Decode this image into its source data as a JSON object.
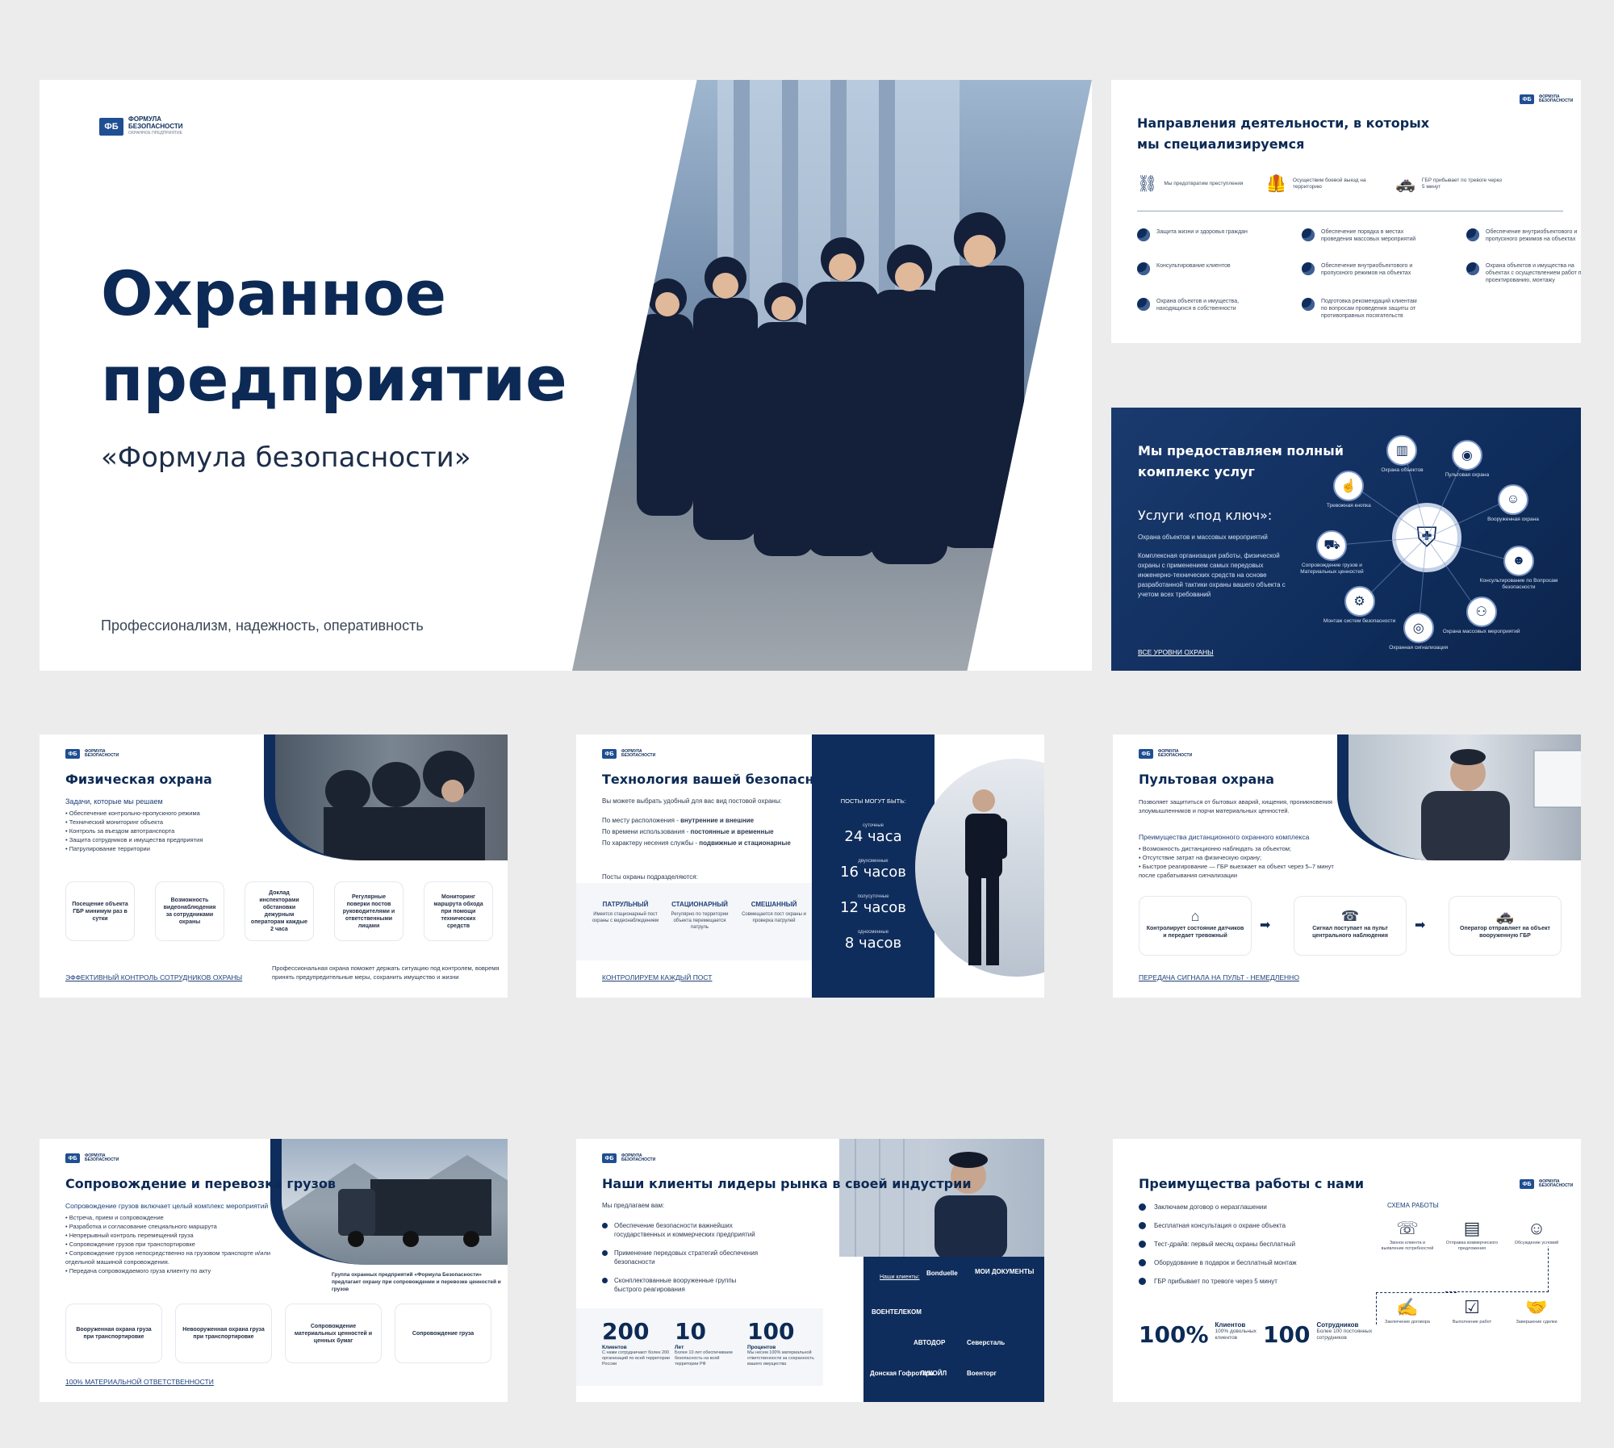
{
  "logo": {
    "mark": "ФБ",
    "line1": "Формула",
    "line2": "безопасности",
    "sub": "охранное предприятие"
  },
  "s1": {
    "title_l1": "Охранное",
    "title_l2": "предприятие",
    "subtitle": "«Формула безопасности»",
    "tagline": "Профессионализм, надежность, оперативность"
  },
  "s2": {
    "title_l1": "Направления деятельности, в которых",
    "title_l2": "мы специализируемся",
    "top": [
      {
        "icon": "handcuffs-icon",
        "glyph": "⛓",
        "text": "Мы предотвратим преступления"
      },
      {
        "icon": "vest-icon",
        "glyph": "🦺",
        "text": "Осуществим боевой выезд на территорию"
      },
      {
        "icon": "car-icon",
        "glyph": "🚓",
        "text": "ГБР прибывает по тревоге через 5 минут"
      }
    ],
    "items": [
      "Защита жизни и здоровья граждан",
      "Обеспечение порядка в местах проведения массовых мероприятий",
      "Обеспечение внутриобъектового и пропускного режимов на объектах",
      "Консультирование клиентов",
      "Обеспечение внутриобъектового и пропускного режимов на объектах",
      "Охрана объектов и имущества на объектах с осуществлением работ по проектированию, монтажу",
      "Охрана объектов и имущества, находящихся в собственности",
      "Подготовка рекомендаций клиентам по вопросам проведения защиты от противоправных посягательств"
    ]
  },
  "s3": {
    "title_l1": "Мы предоставляем полный",
    "title_l2": "комплекс услуг",
    "turnkey": "Услуги «под ключ»:",
    "turnkey_sub": "Охрана объектов и массовых мероприятий",
    "body": "Комплексная организация работы, физической охраны с применением самых передовых инженерно-технических средств на основе разработанной тактики охраны вашего объекта с учетом всех требований",
    "link": "Все уровни охраны",
    "nodes": [
      {
        "label": "Охрана объектов",
        "glyph": "▥"
      },
      {
        "label": "Пультовая охрана",
        "glyph": "◉"
      },
      {
        "label": "Вооруженная охрана",
        "glyph": "☺"
      },
      {
        "label": "Консультирование по Вопросам безопасности",
        "glyph": "☻"
      },
      {
        "label": "Охрана массовых мероприятий",
        "glyph": "⚇"
      },
      {
        "label": "Охранная сигнализация",
        "glyph": "◎"
      },
      {
        "label": "Монтаж систем безопасности",
        "glyph": "⚙"
      },
      {
        "label": "Сопровождение грузов и Материальных ценностей",
        "glyph": "⛟"
      },
      {
        "label": "Тревожная кнопка",
        "glyph": "☝"
      }
    ]
  },
  "s4": {
    "title": "Физическая охрана",
    "tasks_title": "Задачи, которые мы решаем",
    "tasks": [
      "Обеспечение контрольно-пропускного режима",
      "Технический мониторинг объекта",
      "Контроль за въездом автотранспорта",
      "Защита сотрудников и имущества предприятия",
      "Патрулирование территории"
    ],
    "cards": [
      "Посещение объекта ГБР минимум раз в сутки",
      "Возможность видеонаблюдения за сотрудниками охраны",
      "Доклад инспекторами обстановки дежурным операторам каждые 2 часа",
      "Регулярные поверки постов руководителями и ответственными лицами",
      "Мониторинг маршрута обхода при помощи технических средств"
    ],
    "note": "Профессиональная охрана поможет держать ситуацию под контролем, вовремя принять предупредительные меры, сохранить имущество и жизни",
    "link": "Эффективный контроль сотрудников охраны"
  },
  "s5": {
    "title": "Технология вашей безопасности",
    "intro": "Вы можете выбрать удобный для вас вид постовой охраны:",
    "rows": [
      {
        "a": "По месту расположения - ",
        "b": "внутренние и внешние"
      },
      {
        "a": "По времени использования - ",
        "b": "постоянные и временные"
      },
      {
        "a": "По характеру несения службы - ",
        "b": "подвижные и стационарные"
      }
    ],
    "posts_title": "Посты охраны подразделяются:",
    "posts": [
      {
        "name": "Патрульный",
        "desc": "Имеется стационарный пост охраны с видеонаблюдением"
      },
      {
        "name": "Стационарный",
        "desc": "Регулярно по территории объекта перемещается патруль"
      },
      {
        "name": "Смешанный",
        "desc": "Совмещается пост охраны и проверка патрулей"
      }
    ],
    "side_title": "Посты могут быть:",
    "hours": [
      {
        "sub": "суточные",
        "value": "24 часа"
      },
      {
        "sub": "двухсменные",
        "value": "16 часов"
      },
      {
        "sub": "полусуточные",
        "value": "12 часов"
      },
      {
        "sub": "односменные",
        "value": "8 часов"
      }
    ],
    "link": "Контролируем каждый пост"
  },
  "s6": {
    "title": "Пультовая охрана",
    "intro": "Позволяет защититься от бытовых аварий, хищения, проникновения злоумышленников и порчи материальных ценностей.",
    "adv_title": "Преимущества дистанционного охранного комплекса",
    "adv": [
      "Возможность дистанционно наблюдать за объектом;",
      "Отсутствие затрат на физическую охрану;",
      "Быстрое реагирование — ГБР выезжает на объект через 5–7 минут после срабатывания сигнализации"
    ],
    "steps": [
      {
        "glyph": "⌂",
        "text": "Контролирует состояние датчиков и передает тревожный"
      },
      {
        "glyph": "☎",
        "text": "Сигнал поступает на пульт центрального наблюдения"
      },
      {
        "glyph": "🚓",
        "text": "Оператор отправляет на объект вооруженную ГБР"
      }
    ],
    "arrow": "➡",
    "link": "Передача сигнала на пульт - немедленно"
  },
  "s7": {
    "title": "Сопровождение и перевозка грузов",
    "sub": "Сопровождение грузов включает целый комплекс мероприятий",
    "list": [
      "Встреча, прием и сопровождение",
      "Разработка и согласование специального маршрута",
      "Непрерывный контроль перемещений груза",
      "Сопровождение грузов при транспортировке",
      "Сопровождение грузов непосредственно на грузовом транспорте и/или отдельной машиной сопровождения.",
      "Передача сопровождаемого груза клиенту по акту"
    ],
    "note": "Группа охранных предприятий «Формула Безопасности» предлагает охрану при сопровождении и перевозке ценностей и грузов",
    "cards": [
      "Вооруженная охрана груза при транспортировке",
      "Невооруженная охрана груза при транспортировке",
      "Сопровождение материальных ценностей и ценных бумаг",
      "Сопровождение груза"
    ],
    "link": "100% материальной ответственности"
  },
  "s8": {
    "title": "Наши клиенты лидеры рынка в своей индустрии",
    "offer": "Мы предлагаем вам:",
    "items": [
      "Обеспечение безопасности важнейших государственных и коммерческих предприятий",
      "Применение передовых стратегий обеспечения безопасности",
      "Сконплектованные вооруженные группы быстрого реагирования"
    ],
    "stats": [
      {
        "value": "200",
        "label": "Клиентов",
        "desc": "С нами сотрудничают более 200 организаций по всей территории России"
      },
      {
        "value": "10",
        "label": "Лет",
        "desc": "Более 10 лет обеспечиваем безопасность на всей территории РФ"
      },
      {
        "value": "100",
        "label": "Процентов",
        "desc": "Мы несем 100% материальной ответственности за сохранность вашего имущества"
      }
    ],
    "clients_title": "Наши клиенты:",
    "clients": [
      "Bonduelle",
      "МОИ ДОКУМЕНТЫ",
      "ВОЕНТЕЛЕКОМ",
      "АВТОДОР",
      "Северсталь",
      "Донская Гофротара",
      "ЛУКОЙЛ",
      "Военторг"
    ]
  },
  "s9": {
    "title": "Преимущества работы с нами",
    "items": [
      "Заключаем договор о неразглашении",
      "Бесплатная консультация о охране объекта",
      "Тест-драйв: первый месяц охраны бесплатный",
      "Оборудование в подарок и бесплатный монтаж",
      "ГБР прибывает по тревоге через 5 минут"
    ],
    "scheme_title": "Схема работы",
    "scheme": [
      {
        "glyph": "☏",
        "text": "Звонок клиента и выявление потребностей"
      },
      {
        "glyph": "▤",
        "text": "Отправка коммерческого предложения"
      },
      {
        "glyph": "☺",
        "text": "Обсуждение условий"
      },
      {
        "glyph": "✍",
        "text": "Заключение договора"
      },
      {
        "glyph": "☑",
        "text": "Выполнение работ"
      },
      {
        "glyph": "🤝",
        "text": "Завершение сделки"
      }
    ],
    "stat1": {
      "value": "100%",
      "label": "Клиентов",
      "desc": "100% довольных клиентов"
    },
    "stat2": {
      "value": "100",
      "label": "Сотрудников",
      "desc": "Более 100 постоянных сотрудников"
    }
  }
}
